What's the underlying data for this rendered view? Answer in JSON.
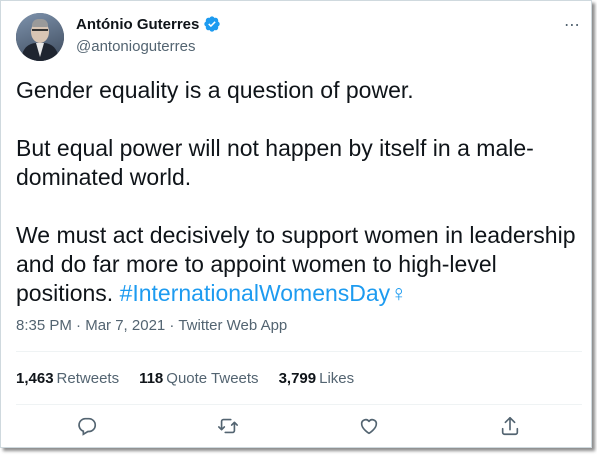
{
  "author": {
    "name": "António Guterres",
    "handle": "@antonioguterres"
  },
  "more_icon": "⋯",
  "tweet": {
    "para1": "Gender equality is a question of power.",
    "para2": "But equal power will not happen by itself in a male-dominated world.",
    "para3_text": "We must act decisively to support women in leadership and do far more to appoint women to high-level positions. ",
    "hashtag": "#InternationalWomensDay",
    "emoji": "♀"
  },
  "meta": {
    "time": "8:35 PM",
    "date": "Mar 7, 2021",
    "source": "Twitter Web App",
    "separator": " · "
  },
  "stats": {
    "retweets_count": "1,463",
    "retweets_label": "Retweets",
    "quotes_count": "118",
    "quotes_label": "Quote Tweets",
    "likes_count": "3,799",
    "likes_label": "Likes"
  },
  "colors": {
    "accent": "#1d9bf0",
    "text": "#0f1419",
    "secondary": "#536471"
  },
  "actions": [
    "reply-icon",
    "retweet-icon",
    "like-icon",
    "share-icon"
  ]
}
